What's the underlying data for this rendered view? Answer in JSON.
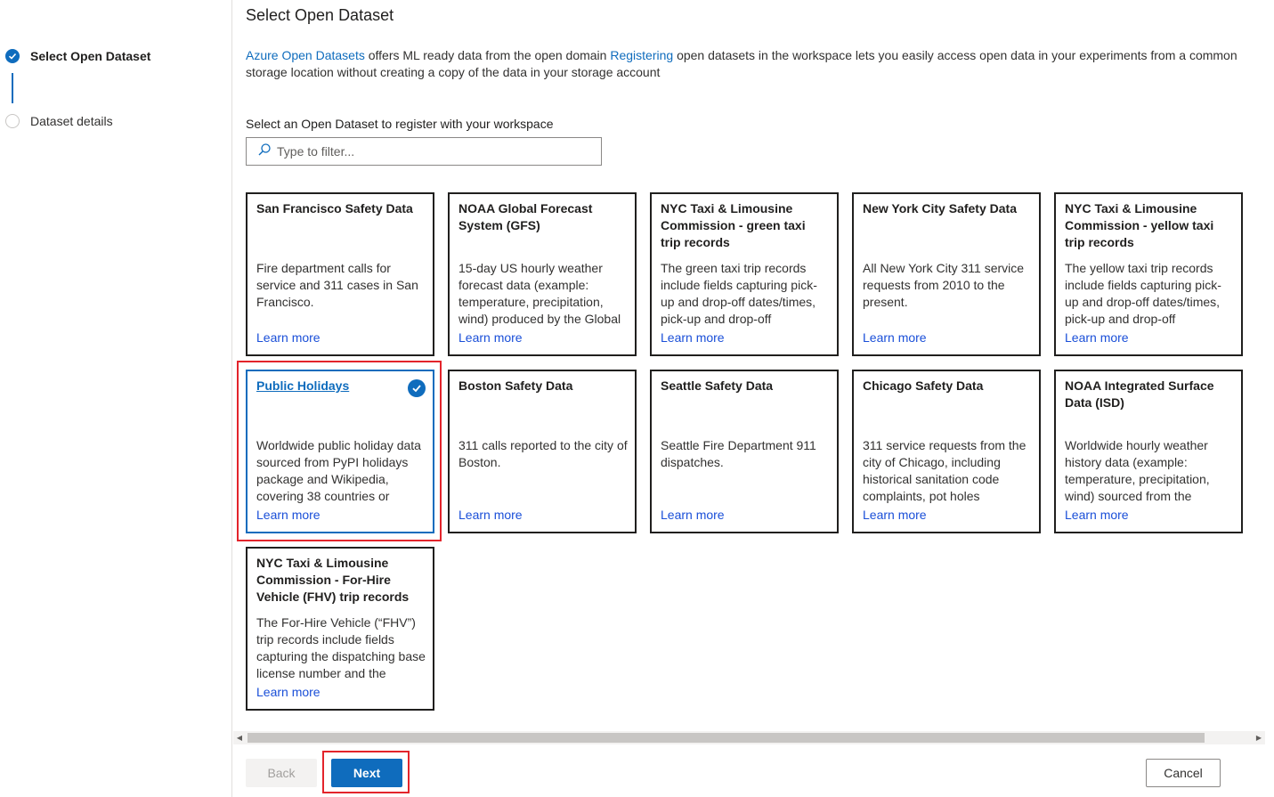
{
  "stepper": {
    "steps": [
      {
        "label": "Select Open Dataset",
        "state": "completed"
      },
      {
        "label": "Dataset details",
        "state": "pending"
      }
    ]
  },
  "main": {
    "title": "Select Open Dataset",
    "intro": {
      "link1": "Azure Open Datasets",
      "text1": " offers ML ready data from the open domain ",
      "link2": "Registering",
      "text2": " open datasets in the workspace lets you easily access open data in your experiments from a common storage location without creating a copy of the data in your storage account"
    },
    "filter_label": "Select an Open Dataset to register with your workspace",
    "filter": {
      "placeholder": "Type to filter...",
      "value": ""
    },
    "cards": [
      {
        "title": "San Francisco Safety Data",
        "description": "Fire department calls for service and 311 cases in San Francisco.",
        "link": "Learn more",
        "selected": false
      },
      {
        "title": "NOAA Global Forecast System (GFS)",
        "description": "15-day US hourly weather forecast data (example: temperature, precipitation, wind) produced by the Global",
        "link": "Learn more",
        "selected": false
      },
      {
        "title": "NYC Taxi & Limousine Commission - green taxi trip records",
        "description": "The green taxi trip records include fields capturing pick-up and drop-off dates/times, pick-up and drop-off",
        "link": "Learn more",
        "selected": false
      },
      {
        "title": "New York City Safety Data",
        "description": "All New York City 311 service requests from 2010 to the present.",
        "link": "Learn more",
        "selected": false
      },
      {
        "title": "NYC Taxi & Limousine Commission - yellow taxi trip records",
        "description": "The yellow taxi trip records include fields capturing pick-up and drop-off dates/times, pick-up and drop-off",
        "link": "Learn more",
        "selected": false
      },
      {
        "title": "Public Holidays",
        "description": "Worldwide public holiday data sourced from PyPI holidays package and Wikipedia, covering 38 countries or",
        "link": "Learn more",
        "selected": true
      },
      {
        "title": "Boston Safety Data",
        "description": "311 calls reported to the city of Boston.",
        "link": "Learn more",
        "selected": false
      },
      {
        "title": "Seattle Safety Data",
        "description": "Seattle Fire Department 911 dispatches.",
        "link": "Learn more",
        "selected": false
      },
      {
        "title": "Chicago Safety Data",
        "description": "311 service requests from the city of Chicago, including historical sanitation code complaints, pot holes",
        "link": "Learn more",
        "selected": false
      },
      {
        "title": "NOAA Integrated Surface Data (ISD)",
        "description": "Worldwide hourly weather history data (example: temperature, precipitation, wind) sourced from the",
        "link": "Learn more",
        "selected": false
      },
      {
        "title": "NYC Taxi & Limousine Commission - For-Hire Vehicle (FHV) trip records",
        "description": "The For-Hire Vehicle (“FHV”) trip records include fields capturing the dispatching base license number and the",
        "link": "Learn more",
        "selected": false
      }
    ]
  },
  "footer": {
    "back_label": "Back",
    "next_label": "Next",
    "cancel_label": "Cancel"
  },
  "colors": {
    "accent": "#0f6cbd",
    "highlight_annotation": "#e3242b",
    "link": "#1a4fd8"
  }
}
